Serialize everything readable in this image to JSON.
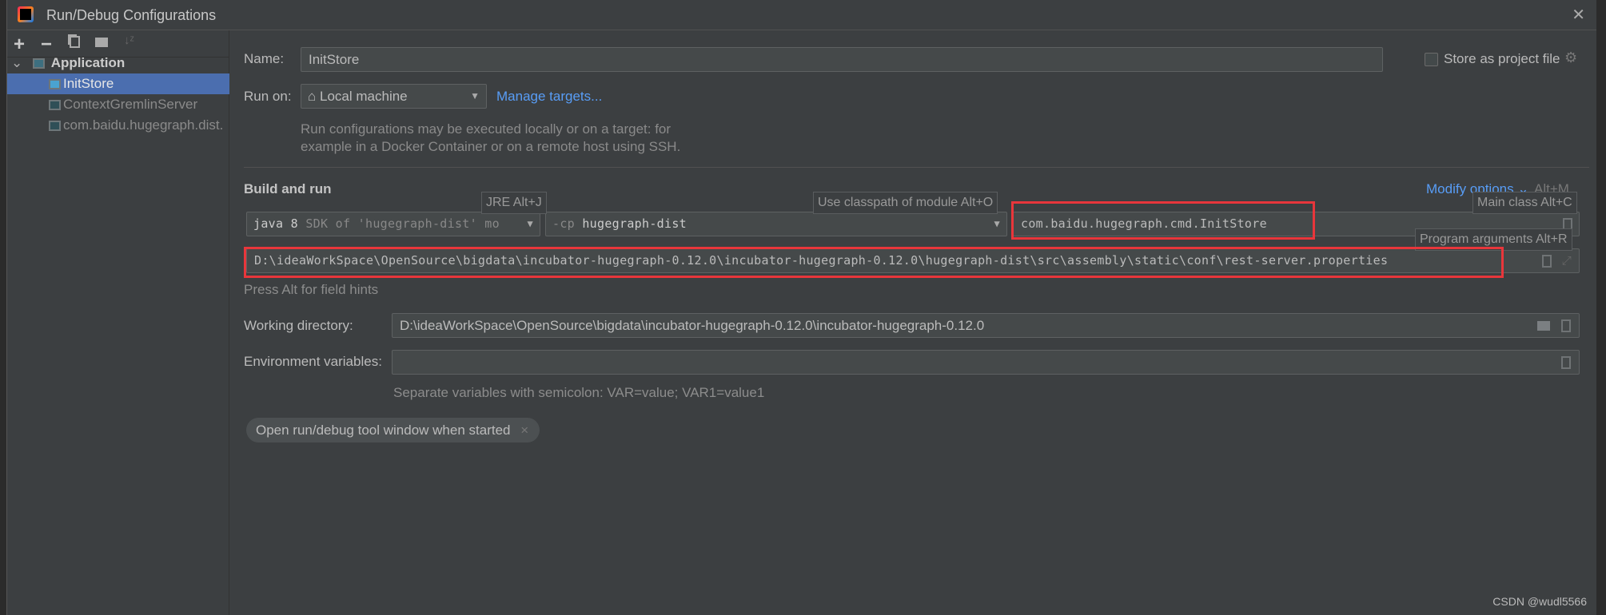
{
  "window": {
    "title": "Run/Debug Configurations",
    "close_icon": "close-icon"
  },
  "toolbar": {
    "icons": [
      "add-icon",
      "remove-icon",
      "copy-icon",
      "new-folder-icon",
      "sort-icon"
    ],
    "add": "+",
    "remove": "−"
  },
  "tree": {
    "group": "Application",
    "items": [
      {
        "label": "InitStore",
        "selected": true
      },
      {
        "label": "ContextGremlinServer",
        "selected": false
      },
      {
        "label": "com.baidu.hugegraph.dist.",
        "selected": false
      }
    ]
  },
  "form": {
    "name_label": "Name:",
    "name_value": "InitStore",
    "store_as_project_file": "Store as project file",
    "store_checked": false,
    "run_on_label": "Run on:",
    "run_on_value": "Local machine",
    "manage_targets": "Manage targets...",
    "run_on_desc_1": "Run configurations may be executed locally or on a target: for",
    "run_on_desc_2": "example in a Docker Container or on a remote host using SSH.",
    "build_and_run": "Build and run",
    "modify_options": "Modify options",
    "modify_shortcut": "Alt+M",
    "jre_tip": "JRE Alt+J",
    "cp_tip": "Use classpath of module Alt+O",
    "main_class_tip": "Main class Alt+C",
    "program_args_tip": "Program arguments Alt+R",
    "jre_java": "java 8",
    "jre_sdk": "SDK of 'hugegraph-dist' mo",
    "cp_flag": "-cp",
    "cp_module": "hugegraph-dist",
    "main_class": "com.baidu.hugegraph.cmd.InitStore",
    "program_args": "D:\\ideaWorkSpace\\OpenSource\\bigdata\\incubator-hugegraph-0.12.0\\incubator-hugegraph-0.12.0\\hugegraph-dist\\src\\assembly\\static\\conf\\rest-server.properties",
    "field_hint": "Press Alt for field hints",
    "working_dir_label": "Working directory:",
    "working_dir_value": "D:\\ideaWorkSpace\\OpenSource\\bigdata\\incubator-hugegraph-0.12.0\\incubator-hugegraph-0.12.0",
    "env_label": "Environment variables:",
    "env_value": "",
    "env_hint": "Separate variables with semicolon: VAR=value; VAR1=value1",
    "chip": "Open run/debug tool window when started"
  },
  "watermark": "CSDN @wudl5566",
  "colors": {
    "background": "#3c3f41",
    "selection": "#4b6eaf",
    "link": "#589df6",
    "highlight_box": "#e8363b"
  }
}
